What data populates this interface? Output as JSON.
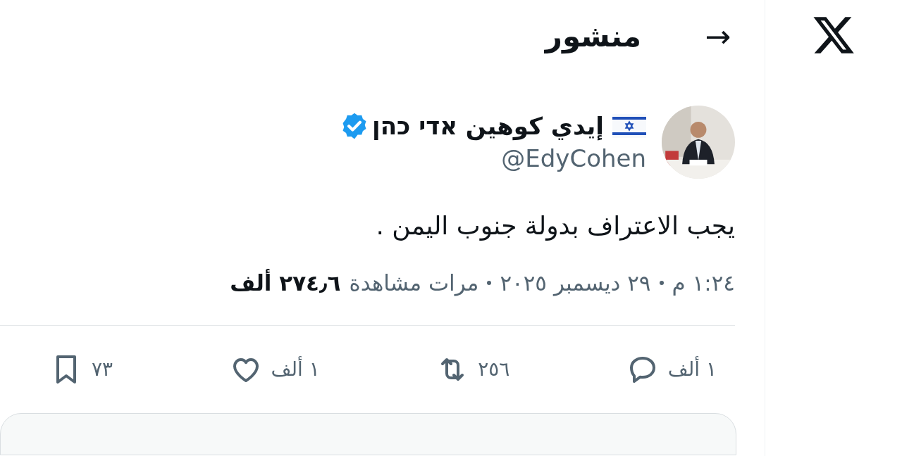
{
  "header": {
    "back": "→",
    "title": "منشور"
  },
  "author": {
    "name": "إيدي كوهين אדי כהן",
    "handle": "@EdyCohen",
    "verified": true
  },
  "post": {
    "text": "يجب الاعتراف بدولة جنوب اليمن ."
  },
  "meta": {
    "time": "١:٢٤ م",
    "date": "٢٩ ديسمبر ٢٠٢٥",
    "views_label": "مرات مشاهدة",
    "views_count": "٢٧٤٫٦ ألف"
  },
  "actions": [
    {
      "kind": "reply",
      "count": "١ ألف"
    },
    {
      "kind": "repost",
      "count": "٢٥٦"
    },
    {
      "kind": "like",
      "count": "١ ألف"
    },
    {
      "kind": "bookmark",
      "count": "٧٣"
    }
  ]
}
